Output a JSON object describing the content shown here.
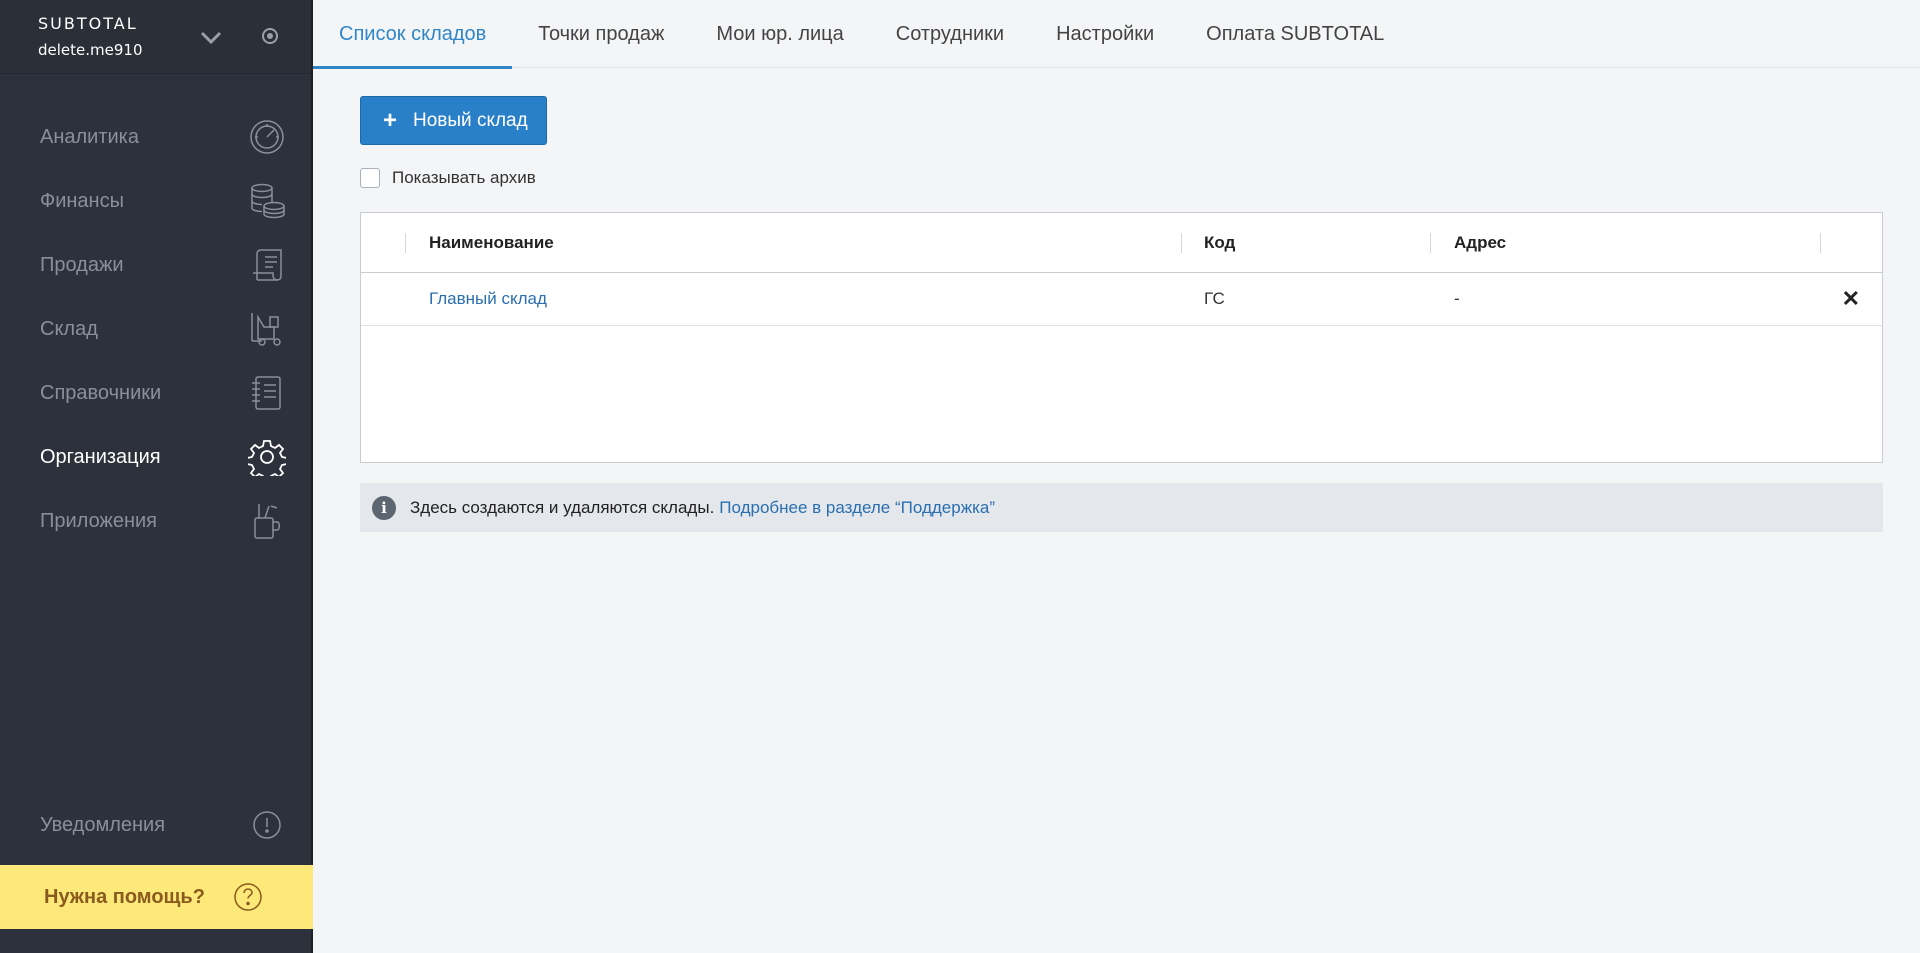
{
  "brand": {
    "name": "SUBTOTAL",
    "user": "delete.me910"
  },
  "sidebar": {
    "items": [
      {
        "label": "Аналитика",
        "icon": "speedometer-icon"
      },
      {
        "label": "Финансы",
        "icon": "coins-icon"
      },
      {
        "label": "Продажи",
        "icon": "receipt-icon"
      },
      {
        "label": "Склад",
        "icon": "forklift-icon"
      },
      {
        "label": "Справочники",
        "icon": "notebook-icon"
      },
      {
        "label": "Организация",
        "icon": "gear-icon",
        "active": true
      },
      {
        "label": "Приложения",
        "icon": "tools-cup-icon"
      }
    ],
    "notifications": "Уведомления",
    "help": "Нужна помощь?"
  },
  "tabs": [
    {
      "label": "Список складов",
      "active": true
    },
    {
      "label": "Точки продаж"
    },
    {
      "label": "Мои юр. лица"
    },
    {
      "label": "Сотрудники"
    },
    {
      "label": "Настройки"
    },
    {
      "label": "Оплата SUBTOTAL"
    }
  ],
  "toolbar": {
    "new_label": "Новый склад",
    "archive_label": "Показывать архив"
  },
  "table": {
    "columns": [
      "Наименование",
      "Код",
      "Адрес"
    ],
    "rows": [
      {
        "name": "Главный склад",
        "code": "ГС",
        "address": "-"
      }
    ]
  },
  "info": {
    "text": "Здесь создаются и удаляются склады.",
    "link": "Подробнее в разделе “Поддержка”"
  },
  "colors": {
    "accent": "#2a80c8",
    "sidebar": "#2c313b",
    "help": "#fce97a"
  }
}
